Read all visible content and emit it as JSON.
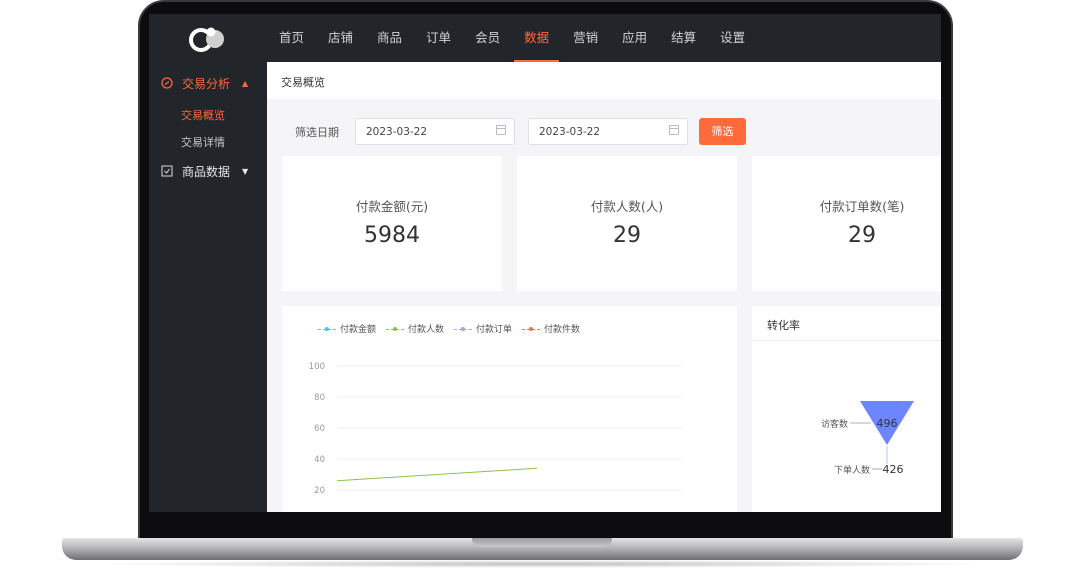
{
  "nav": {
    "items": [
      "首页",
      "店铺",
      "商品",
      "订单",
      "会员",
      "数据",
      "营销",
      "应用",
      "结算",
      "设置"
    ],
    "active_index": 5
  },
  "sidebar": {
    "group1": {
      "label": "交易分析",
      "icon": "trade-analysis-icon"
    },
    "group1_items": [
      "交易概览",
      "交易详情"
    ],
    "group2": {
      "label": "商品数据",
      "icon": "product-data-icon"
    }
  },
  "page": {
    "title": "交易概览"
  },
  "filter": {
    "label": "筛选日期",
    "start_date": "2023-03-22",
    "end_date": "2023-03-22",
    "button_label": "筛选"
  },
  "stats": [
    {
      "label": "付款金额(元)",
      "value": "5984"
    },
    {
      "label": "付款人数(人)",
      "value": "29"
    },
    {
      "label": "付款订单数(笔)",
      "value": "29"
    }
  ],
  "colors": {
    "accent": "#ff6a3d",
    "sidebar_bg": "#222529",
    "funnel": "#6b86ff"
  },
  "chart_data": {
    "type": "line",
    "legend": [
      "付款金额",
      "付款人数",
      "付款订单",
      "付款件数"
    ],
    "legend_colors": [
      "#4fc3f7",
      "#8bc34a",
      "#b39ddb",
      "#ff7043"
    ],
    "y_ticks": [
      "100",
      "80",
      "60",
      "40",
      "20"
    ],
    "ylim": [
      0,
      100
    ],
    "series": [
      {
        "name": "付款人数",
        "color": "#8bc34a",
        "values": [
          26,
          34
        ]
      }
    ]
  },
  "funnel": {
    "title": "转化率",
    "stages": [
      {
        "label": "访客数",
        "value": "496"
      },
      {
        "label": "下单人数",
        "value": "426"
      }
    ]
  }
}
